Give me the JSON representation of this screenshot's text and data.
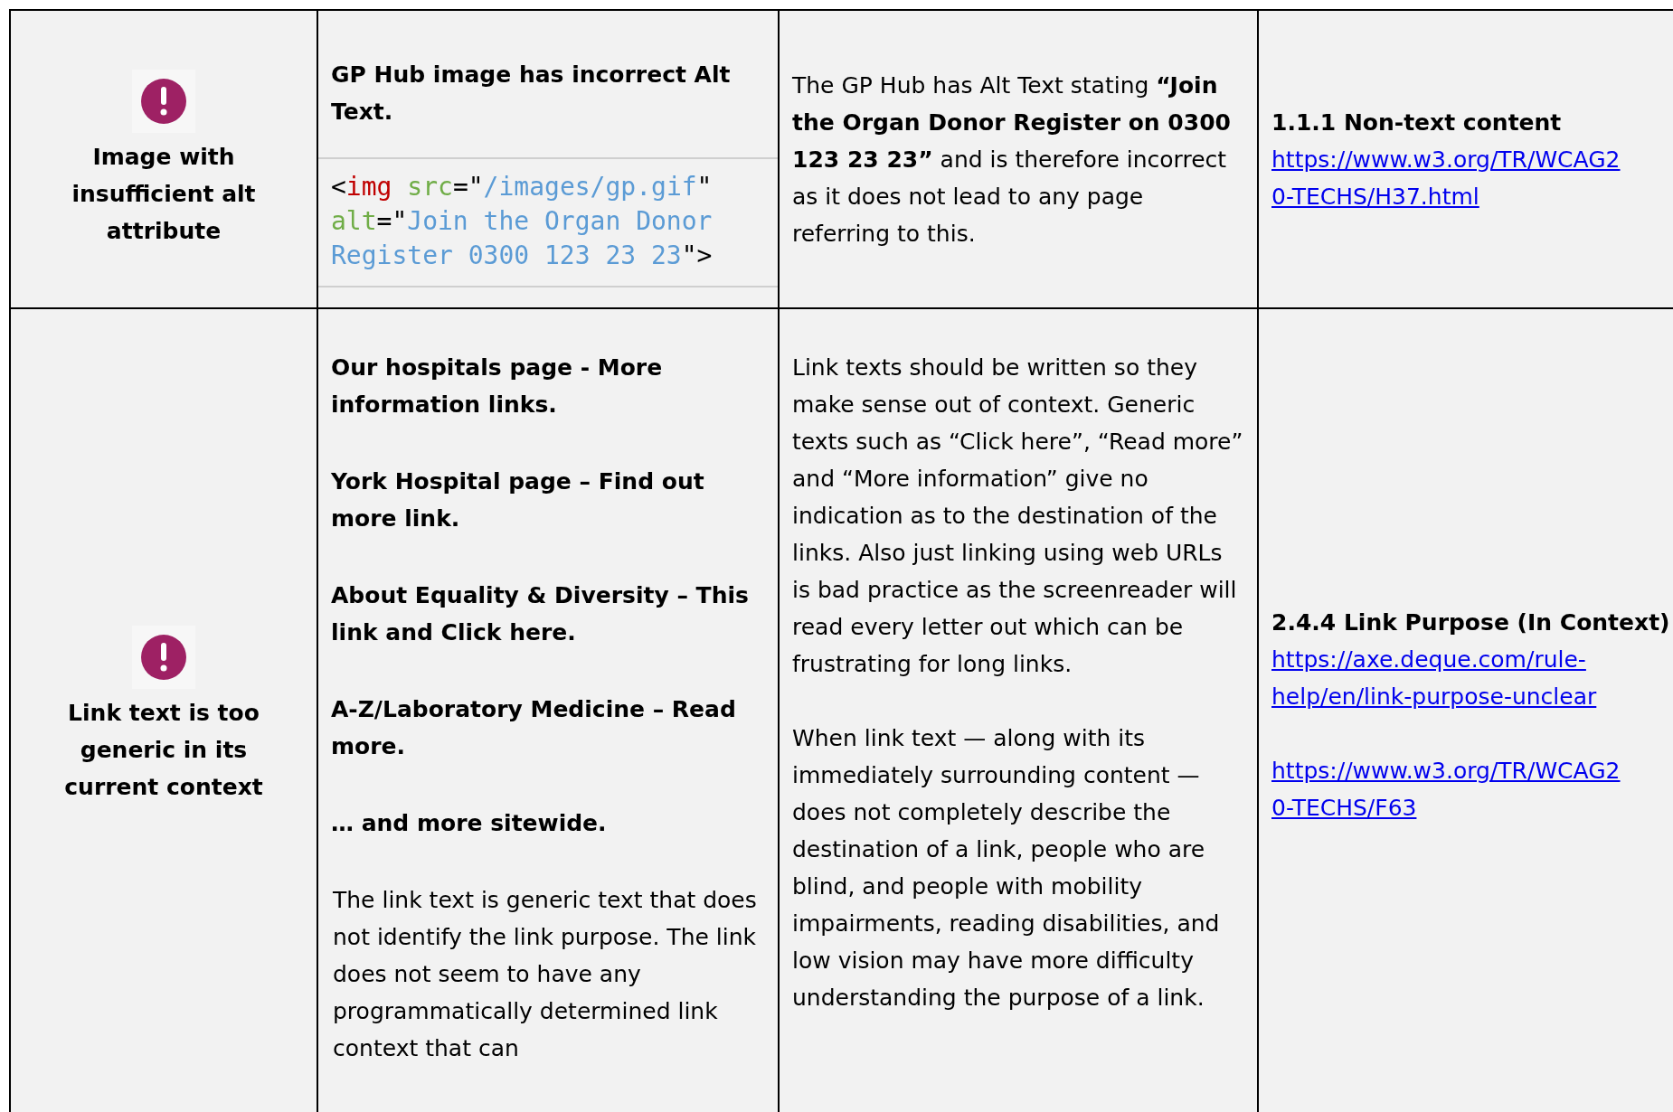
{
  "rows": [
    {
      "issue": {
        "title": "Image with insufficient alt attribute"
      },
      "findings": [
        {
          "kind": "heading",
          "text": "GP Hub image has incorrect Alt Text."
        },
        {
          "kind": "code",
          "tokens": [
            {
              "kind": "punct",
              "text": "<"
            },
            {
              "kind": "tag",
              "text": "img"
            },
            {
              "kind": "attr",
              "text": " src"
            },
            {
              "kind": "punct",
              "text": "=\""
            },
            {
              "kind": "value",
              "text": "/images/gp.gif"
            },
            {
              "kind": "punct",
              "text": "\" "
            },
            {
              "kind": "attr",
              "text": "alt"
            },
            {
              "kind": "punct",
              "text": "=\""
            },
            {
              "kind": "value",
              "text": "Join the Organ Donor Register 0300 123 23 23"
            },
            {
              "kind": "punct",
              "text": "\">"
            }
          ]
        }
      ],
      "description": [
        "The GP Hub has Alt Text stating **“Join the Organ Donor Register on 0300 123 23 23”** and is therefore incorrect as it does not lead to any page referring to this."
      ],
      "reference": {
        "criterion": "1.1.1 Non-text content",
        "links": [
          {
            "lines": [
              "https://www.w3.org/TR/WCAG2",
              "0-TECHS/H37.html"
            ]
          }
        ]
      }
    },
    {
      "issue": {
        "title": "Link text is too generic in its current context"
      },
      "findings": [
        {
          "kind": "heading",
          "text": "Our hospitals page - More information links."
        },
        {
          "kind": "heading",
          "text": "York Hospital page – Find out more link."
        },
        {
          "kind": "heading",
          "text": "About Equality & Diversity – This link and Click here."
        },
        {
          "kind": "heading",
          "text": "A-Z/Laboratory Medicine – Read more."
        },
        {
          "kind": "heading",
          "text": "… and more sitewide."
        },
        {
          "kind": "paragraph",
          "text": "The link text is generic text that does not identify the link purpose. The link does not seem to have any programmatically determined link context that can"
        }
      ],
      "description": [
        "Link texts should be written so they make sense out of context. Generic texts such as “Click here”, “Read more” and “More information” give no indication as to the destination of the links. Also just linking using web URLs is bad practice as the screenreader will read every letter out which can be frustrating for long links.",
        "When link text — along with its immediately surrounding content — does not completely describe the destination of a link, people who are blind, and people with mobility impairments, reading disabilities, and low vision may have more difficulty understanding the purpose of a link."
      ],
      "reference": {
        "criterion": "2.4.4 Link Purpose (In Context)",
        "links": [
          {
            "lines": [
              "https://axe.deque.com/rule-",
              "help/en/link-purpose-unclear"
            ]
          },
          {
            "lines": [
              "https://www.w3.org/TR/WCAG2",
              "0-TECHS/F63"
            ]
          }
        ]
      }
    }
  ]
}
